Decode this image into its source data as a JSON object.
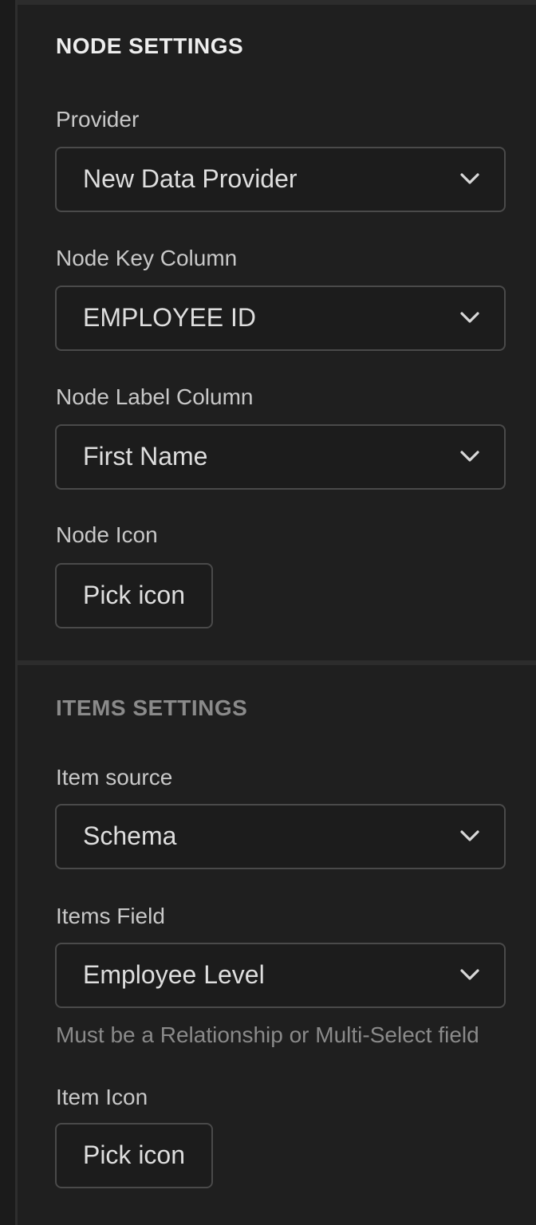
{
  "node_settings": {
    "title": "NODE SETTINGS",
    "provider": {
      "label": "Provider",
      "value": "New Data Provider"
    },
    "key_column": {
      "label": "Node Key Column",
      "value": "EMPLOYEE ID"
    },
    "label_column": {
      "label": "Node Label Column",
      "value": "First Name"
    },
    "icon": {
      "label": "Node Icon",
      "button": "Pick icon"
    }
  },
  "items_settings": {
    "title": "ITEMS SETTINGS",
    "source": {
      "label": "Item source",
      "value": "Schema"
    },
    "field": {
      "label": "Items Field",
      "value": "Employee Level",
      "help": "Must be a Relationship or Multi-Select field"
    },
    "icon": {
      "label": "Item Icon",
      "button": "Pick icon"
    }
  },
  "icons": {
    "dropdown": "chevron-down-icon"
  },
  "colors": {
    "background": "#1f1f1f",
    "border": "#4a4a4a",
    "text": "#dedede",
    "muted": "#8a8a8a"
  }
}
